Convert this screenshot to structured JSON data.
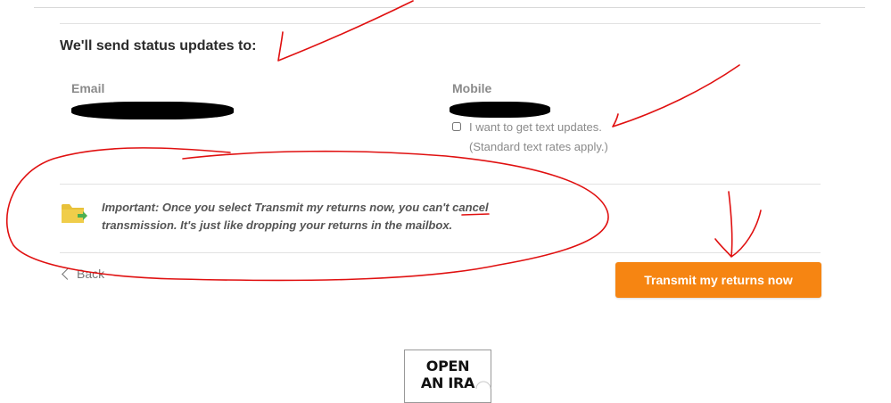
{
  "status": {
    "heading": "We'll send status updates to:",
    "email_label": "Email",
    "mobile_label": "Mobile",
    "text_updates_label": "I want to get text updates.",
    "text_rates_note": "(Standard text rates apply.)",
    "text_updates_checked": false
  },
  "notice": {
    "text": "Important: Once you select Transmit my returns now, you can't cancel transmission. It's just like dropping your returns in the mailbox.",
    "icon": "folder-arrow-icon"
  },
  "nav": {
    "back_label": "Back",
    "transmit_label": "Transmit my returns now"
  },
  "ad": {
    "line1": "OPEN",
    "line2": "AN IRA"
  },
  "colors": {
    "primary_button": "#f68512",
    "annotation_ink": "#e01010",
    "folder": "#e8c13a",
    "folder_arrow": "#4caf50"
  }
}
